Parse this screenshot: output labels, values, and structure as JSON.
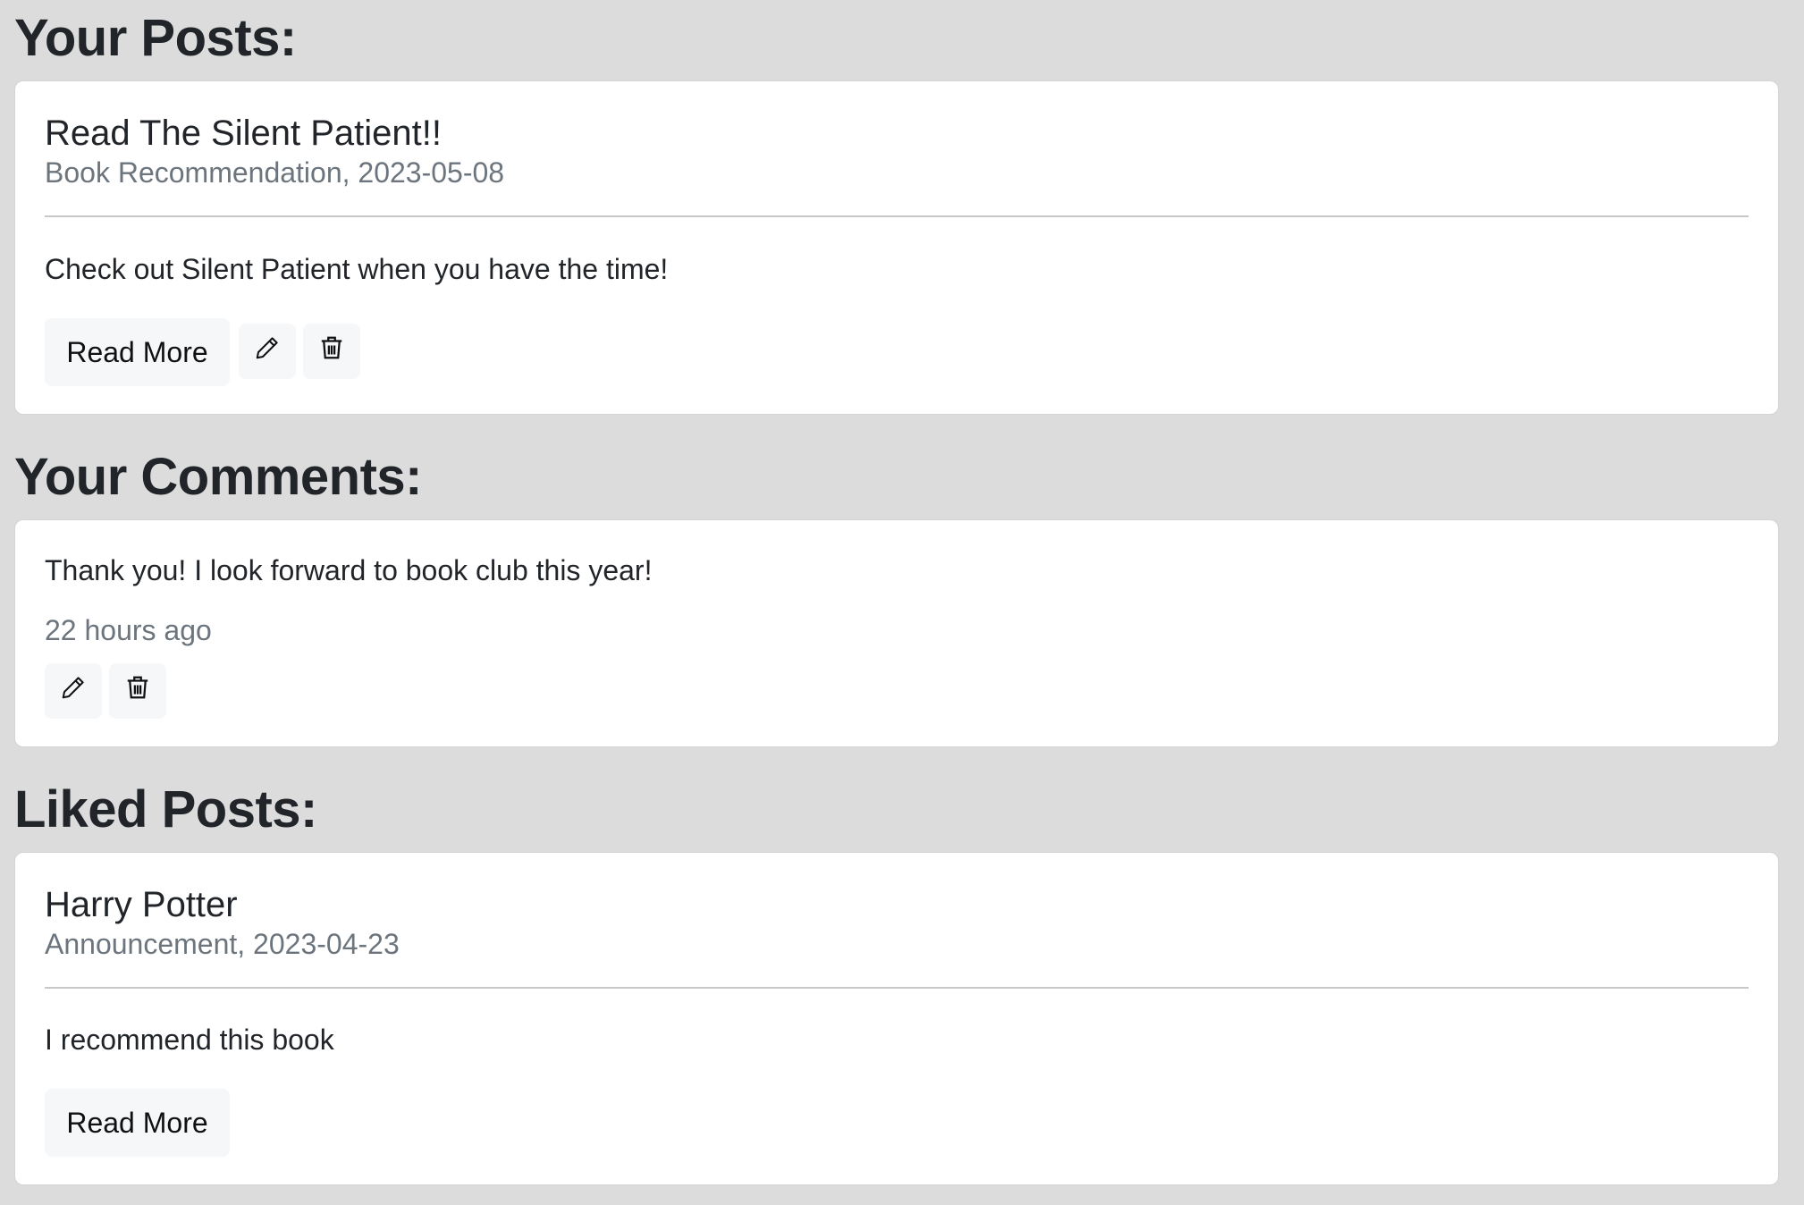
{
  "sections": {
    "your_posts": {
      "heading": "Your Posts:"
    },
    "your_comments": {
      "heading": "Your Comments:"
    },
    "liked_posts": {
      "heading": "Liked Posts:"
    }
  },
  "your_posts": [
    {
      "title": "Read The Silent Patient!!",
      "meta": "Book Recommendation, 2023-05-08",
      "body": "Check out Silent Patient when you have the time!",
      "read_more_label": "Read More",
      "edit_icon": "pencil-icon",
      "delete_icon": "trash-icon"
    }
  ],
  "your_comments": [
    {
      "text": "Thank you! I look forward to book club this year!",
      "time": "22 hours ago",
      "edit_icon": "pencil-icon",
      "delete_icon": "trash-icon"
    }
  ],
  "liked_posts": [
    {
      "title": "Harry Potter",
      "meta": "Announcement, 2023-04-23",
      "body": "I recommend this book",
      "read_more_label": "Read More"
    }
  ],
  "colors": {
    "background": "#dcdcdc",
    "card": "#ffffff",
    "muted_text": "#6c757d",
    "button_bg": "#f6f7f8"
  }
}
